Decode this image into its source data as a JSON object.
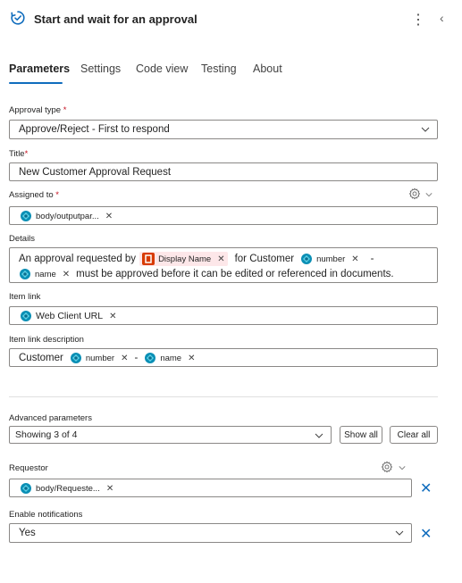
{
  "header": {
    "title": "Start and wait for an approval",
    "more_glyph": "⋮",
    "collapse_glyph": "‹"
  },
  "tabs": [
    {
      "label": "Parameters"
    },
    {
      "label": "Settings"
    },
    {
      "label": "Code view"
    },
    {
      "label": "Testing"
    },
    {
      "label": "About"
    }
  ],
  "fields": {
    "approval_type": {
      "label": "Approval type",
      "required": "*",
      "value": "Approve/Reject - First to respond"
    },
    "title": {
      "label": "Title",
      "required": "*",
      "value": "New Customer Approval Request"
    },
    "assigned_to": {
      "label": "Assigned to",
      "required": "*",
      "token": "body/outputpar..."
    },
    "details": {
      "label": "Details",
      "line1_prefix": "An approval requested by",
      "token_display_name": "Display Name",
      "line1_middle": "for Customer",
      "token_number": "number",
      "line1_suffix": "-",
      "token_name": "name",
      "line2_suffix": "must be approved before it can be edited or referenced in documents."
    },
    "item_link": {
      "label": "Item link",
      "token": "Web Client URL"
    },
    "item_link_description": {
      "label": "Item link description",
      "prefix": "Customer",
      "token_number": "number",
      "separator": "-",
      "token_name": "name"
    }
  },
  "advanced": {
    "label": "Advanced parameters",
    "value": "Showing 3 of 4",
    "show_all": "Show all",
    "clear_all": "Clear all"
  },
  "requestor": {
    "label": "Requestor",
    "token": "body/Requeste..."
  },
  "enable_notifications": {
    "label": "Enable notifications",
    "value": "Yes"
  },
  "glyphs": {
    "remove": "✕",
    "clear": "✕"
  },
  "colors": {
    "accent": "#0f6cbd",
    "required": "#c50f1f",
    "office": "#d83b01"
  }
}
